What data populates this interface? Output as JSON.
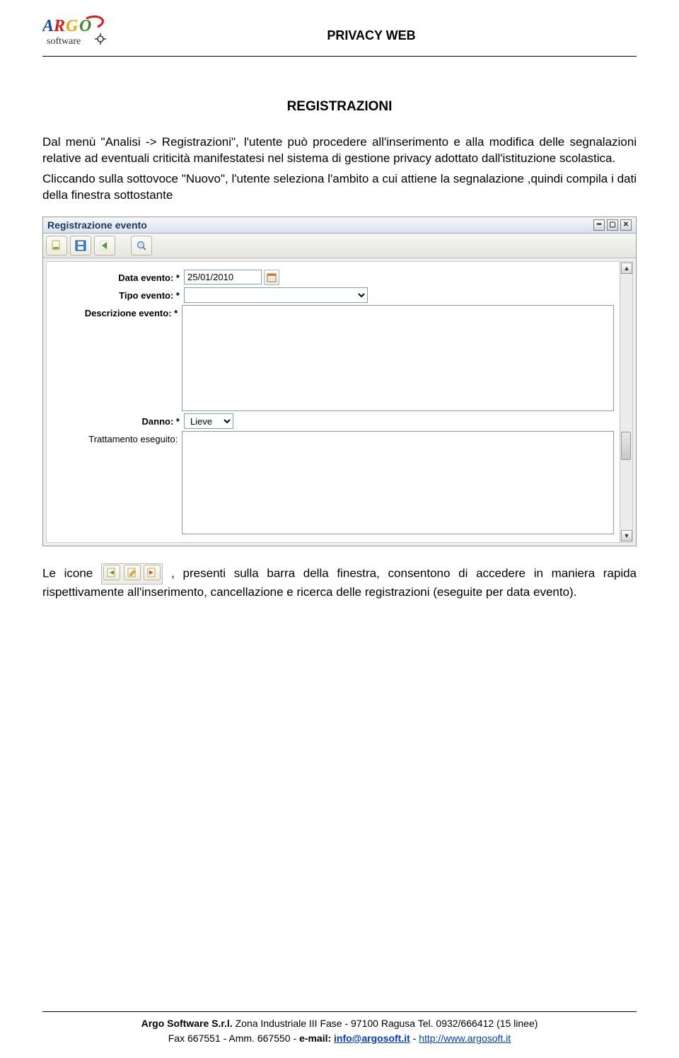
{
  "header": {
    "title": "PRIVACY WEB",
    "logo_main": "ARGO",
    "logo_sub": "software"
  },
  "section": {
    "title": "REGISTRAZIONI",
    "para1": "Dal menù \"Analisi -> Registrazioni\", l'utente può procedere all'inserimento e alla modifica delle segnalazioni relative ad eventuali criticità manifestatesi nel sistema di gestione privacy adottato dall'istituzione scolastica.",
    "para2": "Cliccando sulla sottovoce \"Nuovo\", l'utente seleziona l'ambito a cui attiene la segnalazione ,quindi compila i dati della finestra sottostante"
  },
  "window": {
    "title": "Registrazione evento",
    "labels": {
      "data_evento": "Data evento: *",
      "tipo_evento": "Tipo evento: *",
      "descrizione_evento": "Descrizione evento: *",
      "danno": "Danno: *",
      "trattamento": "Trattamento eseguito:"
    },
    "values": {
      "data_evento": "25/01/2010",
      "tipo_evento": "",
      "descrizione_evento": "",
      "danno": "Lieve",
      "trattamento": ""
    }
  },
  "after": {
    "lead": "Le icone ",
    "rest": ", presenti sulla barra della finestra, consentono di accedere in maniera rapida rispettivamente all'inserimento, cancellazione e ricerca delle registrazioni (eseguite per data evento)."
  },
  "footer": {
    "line1_a": "Argo Software S.r.l.",
    "line1_b": " Zona Industriale III Fase - 97100 Ragusa Tel. 0932/666412 (15 linee)",
    "line2_a": "Fax 667551 - Amm. 667550 - ",
    "line2_b": "e-mail: ",
    "email": "info@argosoft.it",
    "line2_c": " - ",
    "url": "http://www.argosoft.it"
  }
}
